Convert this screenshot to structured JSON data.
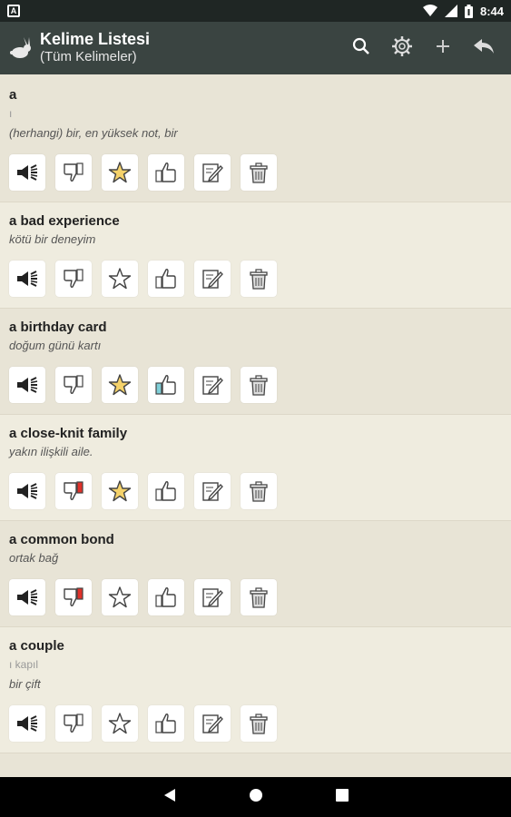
{
  "status_bar": {
    "time": "8:44"
  },
  "app_bar": {
    "title": "Kelime Listesi",
    "subtitle": "(Tüm Kelimeler)",
    "actions": [
      "search-icon",
      "settings-icon",
      "add-icon",
      "back-reply-icon"
    ]
  },
  "colors": {
    "app_bar": "#3a4441",
    "status_bar": "#1f2624",
    "star_fill": "#f5d26a",
    "thumb_down_flag": "#e0312a",
    "thumb_up_fill": "#7fcfd8"
  },
  "items": [
    {
      "word": "a",
      "pronunciation": "ı",
      "meaning": "(herhangi) bir, en yüksek not, bir",
      "starred": true,
      "liked": false,
      "disliked": false
    },
    {
      "word": "a bad experience",
      "pronunciation": "",
      "meaning": "kötü bir deneyim",
      "starred": false,
      "liked": false,
      "disliked": false
    },
    {
      "word": "a birthday card",
      "pronunciation": "",
      "meaning": "doğum günü kartı",
      "starred": true,
      "liked": true,
      "disliked": false
    },
    {
      "word": "a close-knit family",
      "pronunciation": "",
      "meaning": "yakın ilişkili aile.",
      "starred": true,
      "liked": false,
      "disliked": true
    },
    {
      "word": "a common bond",
      "pronunciation": "",
      "meaning": "ortak bağ",
      "starred": false,
      "liked": false,
      "disliked": true
    },
    {
      "word": "a couple",
      "pronunciation": "ı kapıl",
      "meaning": "bir çift",
      "starred": false,
      "liked": false,
      "disliked": false
    }
  ]
}
